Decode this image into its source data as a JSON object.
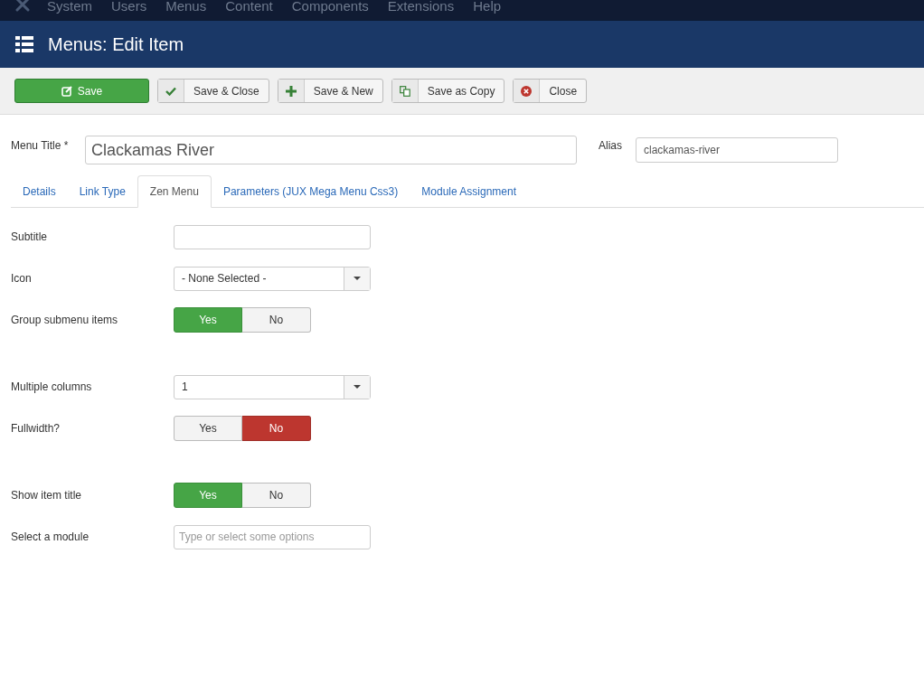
{
  "top_menu": [
    "System",
    "Users",
    "Menus",
    "Content",
    "Components",
    "Extensions",
    "Help"
  ],
  "header": {
    "title": "Menus: Edit Item"
  },
  "toolbar": [
    {
      "label": "Save",
      "kind": "primary"
    },
    {
      "label": "Save & Close",
      "kind": "check"
    },
    {
      "label": "Save & New",
      "kind": "plus"
    },
    {
      "label": "Save as Copy",
      "kind": "copy"
    },
    {
      "label": "Close",
      "kind": "close"
    }
  ],
  "title_field": {
    "label": "Menu Title *",
    "value": "Clackamas River"
  },
  "alias_field": {
    "label": "Alias",
    "value": "clackamas-river"
  },
  "tabs": [
    {
      "label": "Details",
      "selected": false
    },
    {
      "label": "Link Type",
      "selected": false
    },
    {
      "label": "Zen Menu",
      "selected": true
    },
    {
      "label": "Parameters (JUX Mega Menu Css3)",
      "selected": false
    },
    {
      "label": "Module Assignment",
      "selected": false
    }
  ],
  "fields": [
    {
      "label": "Subtitle",
      "kind": "text"
    },
    {
      "label": "Icon",
      "kind": "select",
      "value": "- None Selected -"
    },
    {
      "label": "Group submenu items",
      "kind": "toggle",
      "options": [
        {
          "label": "Yes",
          "selected": true
        },
        {
          "label": "No",
          "selected": false
        }
      ]
    },
    {
      "label": "Multiple columns",
      "kind": "select",
      "value": "1"
    },
    {
      "label": "Fullwidth?",
      "kind": "toggle",
      "options": [
        {
          "label": "Yes",
          "selected": false
        },
        {
          "label": "No",
          "selected": true
        }
      ]
    },
    {
      "label": "Show item title",
      "kind": "toggle",
      "options": [
        {
          "label": "Yes",
          "selected": true
        },
        {
          "label": "No",
          "selected": false
        }
      ]
    },
    {
      "label": "Select a module",
      "kind": "text",
      "placeholder": "Type or select some options"
    }
  ]
}
